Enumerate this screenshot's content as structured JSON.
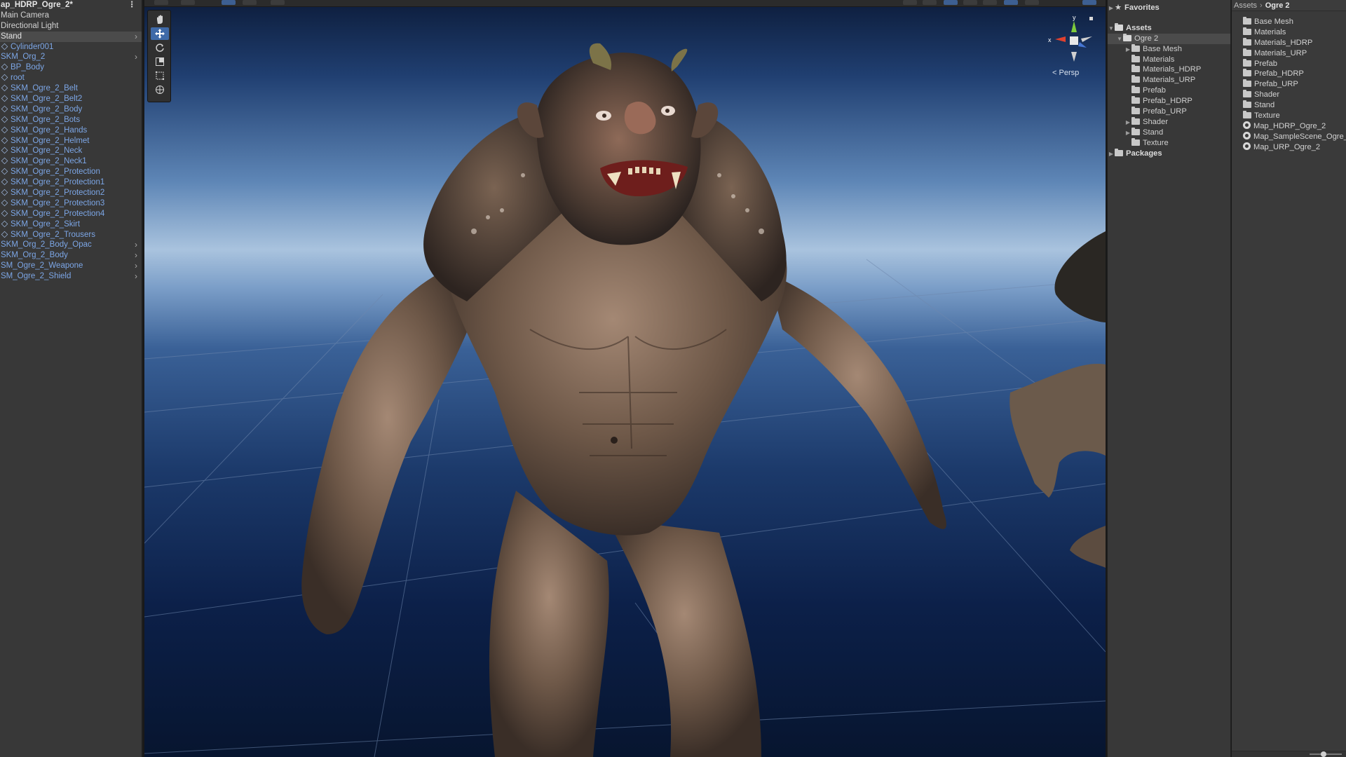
{
  "hierarchy": {
    "scene_title": "ap_HDRP_Ogre_2*",
    "items": [
      {
        "label": "Main Camera",
        "kind": "plain"
      },
      {
        "label": "Directional Light",
        "kind": "plain"
      },
      {
        "label": "Stand",
        "kind": "selected",
        "expandable": true
      },
      {
        "label": "Cylinder001",
        "kind": "prefab-child"
      },
      {
        "label": "SKM_Org_2",
        "kind": "prefab",
        "expandable": true
      },
      {
        "label": "BP_Body",
        "kind": "prefab-child"
      },
      {
        "label": "root",
        "kind": "prefab-child"
      },
      {
        "label": "SKM_Ogre_2_Belt",
        "kind": "prefab-child"
      },
      {
        "label": "SKM_Ogre_2_Belt2",
        "kind": "prefab-child"
      },
      {
        "label": "SKM_Ogre_2_Body",
        "kind": "prefab-child"
      },
      {
        "label": "SKM_Ogre_2_Bots",
        "kind": "prefab-child"
      },
      {
        "label": "SKM_Ogre_2_Hands",
        "kind": "prefab-child"
      },
      {
        "label": "SKM_Ogre_2_Helmet",
        "kind": "prefab-child"
      },
      {
        "label": "SKM_Ogre_2_Neck",
        "kind": "prefab-child"
      },
      {
        "label": "SKM_Ogre_2_Neck1",
        "kind": "prefab-child"
      },
      {
        "label": "SKM_Ogre_2_Protection",
        "kind": "prefab-child"
      },
      {
        "label": "SKM_Ogre_2_Protection1",
        "kind": "prefab-child"
      },
      {
        "label": "SKM_Ogre_2_Protection2",
        "kind": "prefab-child"
      },
      {
        "label": "SKM_Ogre_2_Protection3",
        "kind": "prefab-child"
      },
      {
        "label": "SKM_Ogre_2_Protection4",
        "kind": "prefab-child"
      },
      {
        "label": "SKM_Ogre_2_Skirt",
        "kind": "prefab-child"
      },
      {
        "label": "SKM_Ogre_2_Trousers",
        "kind": "prefab-child"
      },
      {
        "label": "SKM_Org_2_Body_Opac",
        "kind": "prefab",
        "expandable": true
      },
      {
        "label": "SKM_Org_2_Body",
        "kind": "prefab",
        "expandable": true
      },
      {
        "label": "SM_Ogre_2_Weapone",
        "kind": "prefab",
        "expandable": true
      },
      {
        "label": "SM_Ogre_2_Shield",
        "kind": "prefab",
        "expandable": true
      }
    ]
  },
  "scene_view": {
    "projection_label": "Persp",
    "gizmo_axes": {
      "x": "x",
      "y": "y"
    },
    "tools": [
      {
        "name": "hand-tool",
        "active": false
      },
      {
        "name": "move-tool",
        "active": true
      },
      {
        "name": "rotate-tool",
        "active": false
      },
      {
        "name": "scale-tool",
        "active": false
      },
      {
        "name": "rect-tool",
        "active": false
      },
      {
        "name": "transform-tool",
        "active": false
      }
    ],
    "colors": {
      "x_axis": "#e0412f",
      "y_axis": "#7ecb3c",
      "z_axis": "#4a7de0",
      "active_tool": "#3f6aa8"
    }
  },
  "project_tree": {
    "favorites_label": "Favorites",
    "assets_label": "Assets",
    "selected_folder": "Ogre 2",
    "subfolders": [
      {
        "label": "Base Mesh",
        "expandable": true
      },
      {
        "label": "Materials",
        "expandable": false
      },
      {
        "label": "Materials_HDRP",
        "expandable": false
      },
      {
        "label": "Materials_URP",
        "expandable": false
      },
      {
        "label": "Prefab",
        "expandable": false
      },
      {
        "label": "Prefab_HDRP",
        "expandable": false
      },
      {
        "label": "Prefab_URP",
        "expandable": false
      },
      {
        "label": "Shader",
        "expandable": true
      },
      {
        "label": "Stand",
        "expandable": true
      },
      {
        "label": "Texture",
        "expandable": false
      }
    ],
    "packages_label": "Packages"
  },
  "project_content": {
    "breadcrumb": [
      "Assets",
      "Ogre 2"
    ],
    "folders": [
      "Base Mesh",
      "Materials",
      "Materials_HDRP",
      "Materials_URP",
      "Prefab",
      "Prefab_HDRP",
      "Prefab_URP",
      "Shader",
      "Stand",
      "Texture"
    ],
    "scenes": [
      "Map_HDRP_Ogre_2",
      "Map_SampleScene_Ogre_",
      "Map_URP_Ogre_2"
    ]
  }
}
